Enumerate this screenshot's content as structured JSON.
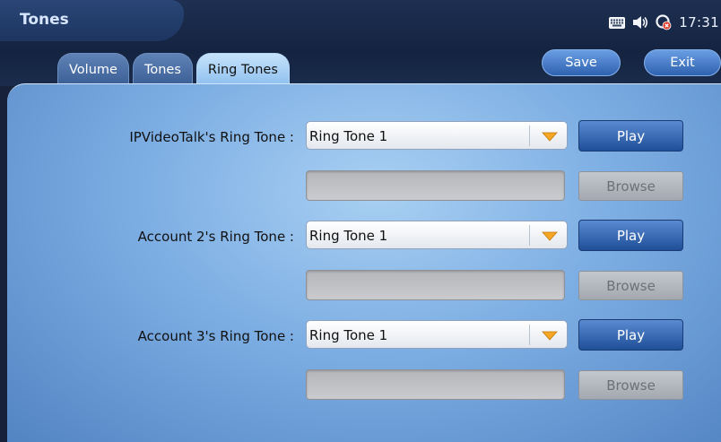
{
  "header": {
    "title": "Tones",
    "time": "17:31",
    "icons": [
      "keyboard-icon",
      "speaker-icon",
      "network-alert-icon"
    ],
    "save_label": "Save",
    "exit_label": "Exit"
  },
  "tabs": [
    {
      "label": "Volume",
      "active": false
    },
    {
      "label": "Tones",
      "active": false
    },
    {
      "label": "Ring Tones",
      "active": true
    }
  ],
  "ring_tones": [
    {
      "label": "IPVideoTalk's Ring Tone :",
      "selected": "Ring Tone 1",
      "play_label": "Play",
      "path_value": "",
      "browse_label": "Browse"
    },
    {
      "label": "Account 2's Ring Tone :",
      "selected": "Ring Tone 1",
      "play_label": "Play",
      "path_value": "",
      "browse_label": "Browse"
    },
    {
      "label": "Account 3's Ring Tone :",
      "selected": "Ring Tone 1",
      "play_label": "Play",
      "path_value": "",
      "browse_label": "Browse"
    }
  ],
  "colors": {
    "accent": "#2e61b0",
    "dropdown_arrow": "#f5a623",
    "panel": "#7daee3",
    "network_alert": "#e03b2a"
  }
}
